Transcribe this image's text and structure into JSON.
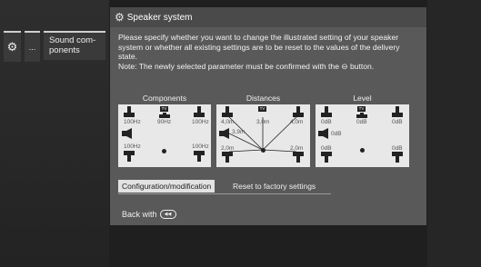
{
  "nav": {
    "gear_icon": "gear-icon",
    "dots": "...",
    "sound_components": "Sound com-\nponents"
  },
  "dialog": {
    "title": "Speaker system",
    "title_icon": "gears-icon",
    "description": "Please specify whether you want to change the illustrated setting of your speaker system or whether all existing settings are to be reset to the values of the delivery state.\nNote: The newly selected parameter must be confirmed with the ⊖ button."
  },
  "panels": {
    "components": {
      "title": "Components",
      "tv": "TV",
      "front_left": "100Hz",
      "center": "90Hz",
      "front_right": "100Hz",
      "rear_left": "100Hz",
      "rear_right": "100Hz"
    },
    "distances": {
      "title": "Distances",
      "tv": "TV",
      "front_left": "4,0m",
      "center": "3,0m",
      "front_right": "4,0m",
      "side": "3,9m",
      "rear_left": "2,0m",
      "rear_right": "2,0m"
    },
    "level": {
      "title": "Level",
      "tv": "TV",
      "front_left": "0dB",
      "center": "0dB",
      "front_right": "0dB",
      "side": "0dB",
      "rear_left": "0dB",
      "rear_right": "0dB"
    }
  },
  "tabs": {
    "active": "Configuration/modification",
    "inactive": "Reset to factory settings"
  },
  "footer": {
    "back_label": "Back with",
    "back_icon": "back-button-icon"
  },
  "colors": {
    "dialog_bg": "#595959",
    "titlebar_bg": "#4a4a4a",
    "panel_bg": "#e8e8e8",
    "active_tab_bg": "#e2e2e2"
  }
}
